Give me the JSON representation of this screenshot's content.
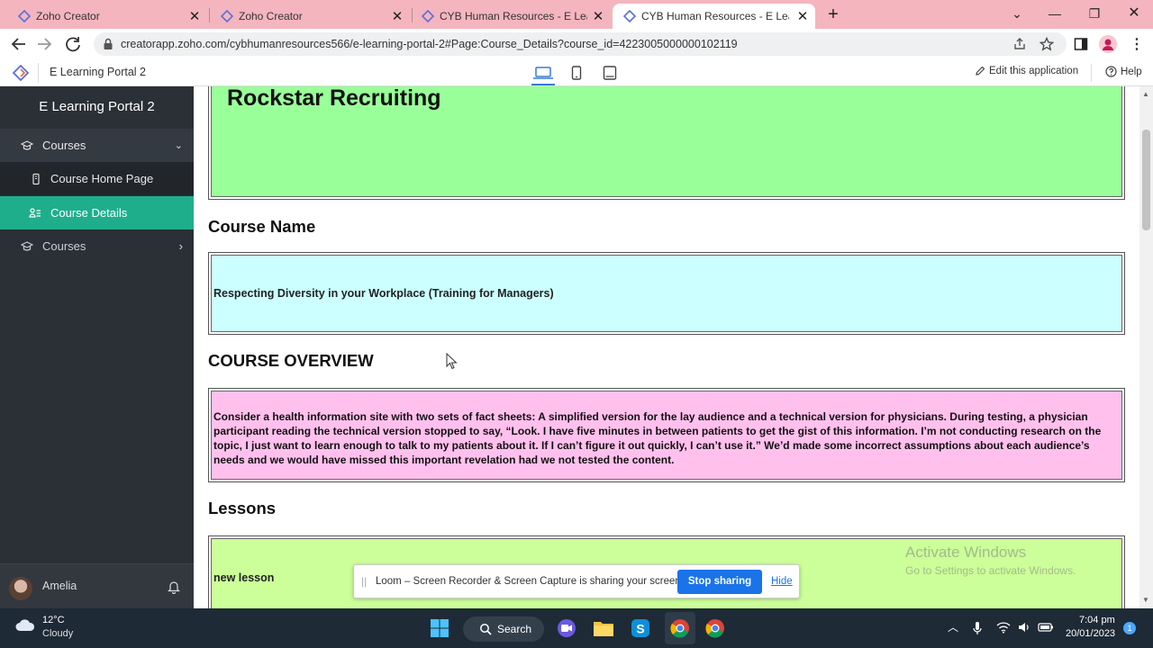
{
  "browser": {
    "tabs": [
      {
        "title": "Zoho Creator",
        "active": false
      },
      {
        "title": "Zoho Creator",
        "active": false
      },
      {
        "title": "CYB Human Resources - E Learni",
        "active": false
      },
      {
        "title": "CYB Human Resources - E Learni",
        "active": true
      }
    ],
    "url": "creatorapp.zoho.com/cybhumanresources566/e-learning-portal-2#Page:Course_Details?course_id=4223005000000102119"
  },
  "appbar": {
    "app_name": "E Learning Portal 2",
    "edit_label": "Edit this application",
    "help_label": "Help"
  },
  "sidebar": {
    "title": "E Learning Portal 2",
    "items": [
      {
        "label": "Courses",
        "icon": "graduation-cap-icon",
        "expanded": true
      },
      {
        "label": "Course Home Page",
        "icon": "page-icon"
      },
      {
        "label": "Course Details",
        "icon": "list-icon",
        "selected": true
      },
      {
        "label": "Courses",
        "icon": "graduation-cap-icon",
        "expanded": false
      }
    ],
    "user": "Amelia"
  },
  "content": {
    "course_title": "Rockstar Recruiting",
    "course_name_heading": "Course Name",
    "course_name": "Respecting Diversity in your Workplace (Training for Managers)",
    "overview_heading": "COURSE OVERVIEW",
    "overview_text": "Consider a health information site with two sets of fact sheets: A simplified version for the lay audience and a technical version for physicians. During testing, a physician participant reading the technical version stopped to say, “Look. I have five minutes in between patients to get the gist of this information. I’m not conducting research on the topic, I just want to learn enough to talk to my patients about it. If I can’t figure it out quickly, I can’t use it.” We’d made some incorrect assumptions about each audience’s needs and we would have missed this important revelation had we not tested the content.",
    "lessons_heading": "Lessons",
    "lesson_1": "new lesson"
  },
  "watermark": {
    "line1": "Activate Windows",
    "line2": "Go to Settings to activate Windows."
  },
  "loom": {
    "message": "Loom – Screen Recorder & Screen Capture is sharing your screen.",
    "stop_label": "Stop sharing",
    "hide_label": "Hide"
  },
  "taskbar": {
    "temperature": "12°C",
    "weather": "Cloudy",
    "search_label": "Search",
    "time": "7:04 pm",
    "date": "20/01/2023",
    "notification_count": "1"
  },
  "colors": {
    "title_bg": "#99ff99",
    "name_bg": "#ccffff",
    "overview_bg": "#ffc0ee",
    "lessons_bg": "#ccff99",
    "sidebar_bg": "#2b3036",
    "sidebar_selected": "#1fae8c",
    "tabbar_bg": "#f4b5bf"
  }
}
